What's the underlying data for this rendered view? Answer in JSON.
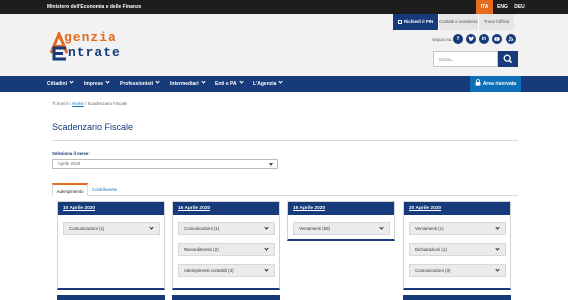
{
  "topbar": {
    "ministry": "Ministero dell'Economia e delle Finanze",
    "languages": [
      "ITA",
      "ENG",
      "DEU"
    ],
    "active_language": "ITA"
  },
  "utility": {
    "pin": "Richiedi il PIN",
    "contatti": "Contatti e assistenza",
    "ufficio": "Trova l'ufficio"
  },
  "logo": {
    "line1": "genzia",
    "line2": "ntrate"
  },
  "social": {
    "label": "Seguici su:",
    "icons": [
      "facebook-icon",
      "twitter-icon",
      "linkedin-icon",
      "youtube-icon",
      "rss-icon"
    ]
  },
  "search": {
    "placeholder": "Cerca..."
  },
  "nav": {
    "items": [
      "Cittadini",
      "Imprese",
      "Professionisti",
      "Intermediari",
      "Enti e PA",
      "L'Agenzia"
    ],
    "area_riservata": "Area riservata"
  },
  "breadcrumb": {
    "prefix": "Ti trovi in:",
    "home": "Home",
    "separator": "/",
    "current": "Scadenzario Fiscale"
  },
  "page": {
    "title": "Scadenzario Fiscale",
    "month_label": "Seleziona il mese:",
    "month_value": "Aprile 2020"
  },
  "tabs": {
    "active": "Adempimento",
    "inactive": "Contribuente"
  },
  "cards": [
    {
      "date": "10 Aprile 2020",
      "items": [
        "Comunicazioni (1)"
      ]
    },
    {
      "date": "15 Aprile 2020",
      "items": [
        "Comunicazioni (1)",
        "Ravvedimento (2)",
        "Adempimenti contabili (3)"
      ]
    },
    {
      "date": "16 Aprile 2020",
      "items": [
        "Versamenti (58)"
      ]
    },
    {
      "date": "20 Aprile 2020",
      "items": [
        "Versamenti (1)",
        "Dichiarazioni (1)",
        "Comunicazioni (3)"
      ]
    }
  ],
  "colors": {
    "brand_blue": "#163a7a",
    "accent_orange": "#e46b1f",
    "link_blue": "#0d6fb7"
  }
}
